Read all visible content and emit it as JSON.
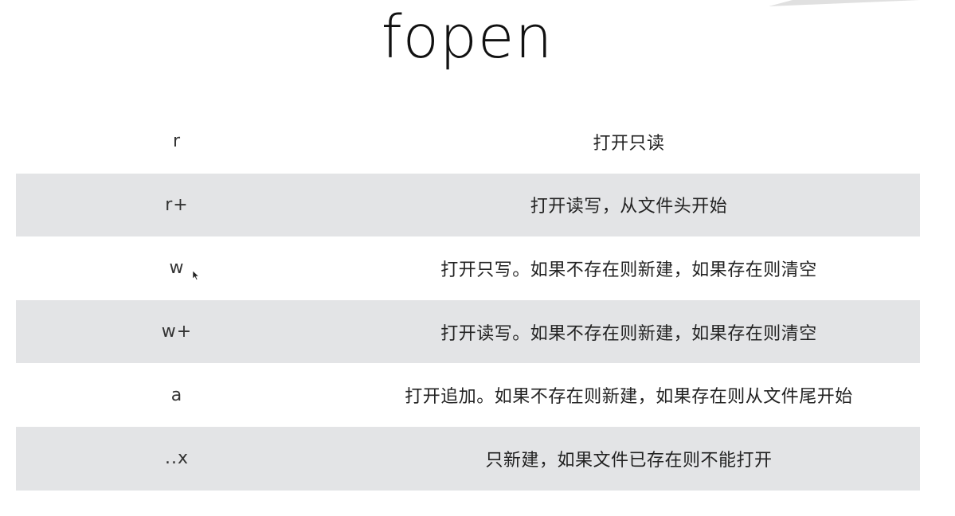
{
  "title": "fopen",
  "rows": [
    {
      "mode": "r",
      "desc": "打开只读"
    },
    {
      "mode": "r+",
      "desc": "打开读写，从文件头开始"
    },
    {
      "mode": "w",
      "desc": "打开只写。如果不存在则新建，如果存在则清空"
    },
    {
      "mode": "w+",
      "desc": "打开读写。如果不存在则新建，如果存在则清空"
    },
    {
      "mode": "a",
      "desc": "打开追加。如果不存在则新建，如果存在则从文件尾开始"
    },
    {
      "mode": "..x",
      "desc": "只新建，如果文件已存在则不能打开"
    }
  ],
  "colors": {
    "row_shade": "#e3e4e6",
    "text": "#222222"
  }
}
